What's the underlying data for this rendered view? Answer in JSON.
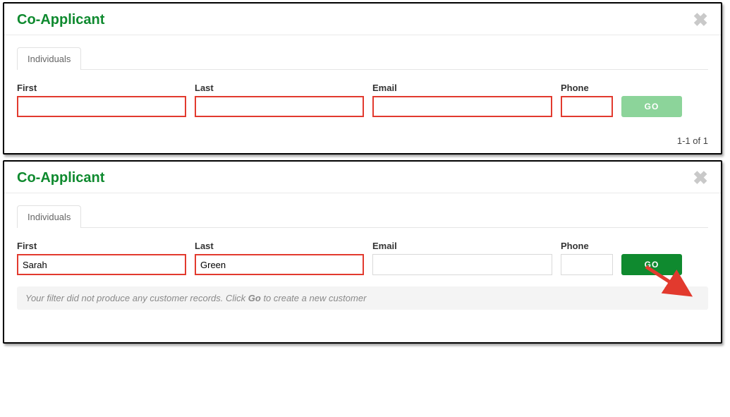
{
  "panel1": {
    "title": "Co-Applicant",
    "tab": "Individuals",
    "labels": {
      "first": "First",
      "last": "Last",
      "email": "Email",
      "phone": "Phone"
    },
    "values": {
      "first": "",
      "last": "",
      "email": "",
      "phone": ""
    },
    "go": "GO",
    "pager": "1-1 of 1"
  },
  "panel2": {
    "title": "Co-Applicant",
    "tab": "Individuals",
    "labels": {
      "first": "First",
      "last": "Last",
      "email": "Email",
      "phone": "Phone"
    },
    "values": {
      "first": "Sarah",
      "last": "Green",
      "email": "",
      "phone": ""
    },
    "go": "GO",
    "msg_a": "Your filter did not produce any customer records. Click ",
    "msg_go": "Go",
    "msg_b": " to create a new customer"
  }
}
